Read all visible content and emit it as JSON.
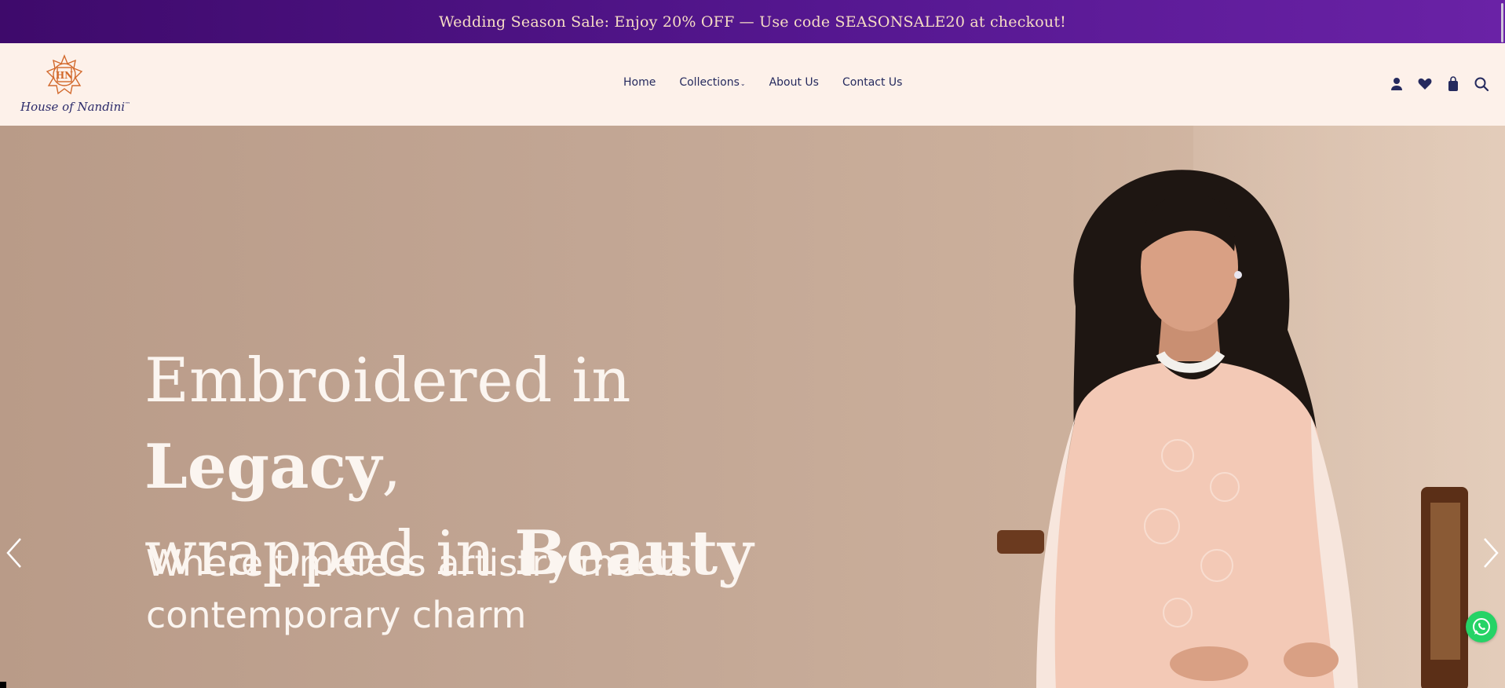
{
  "announcement": {
    "text": "Wedding Season Sale: Enjoy 20% OFF — Use code SEASONSALE20 at checkout!"
  },
  "header": {
    "logo": {
      "monogram": "HN",
      "text": "House of Nandini",
      "tm": "™"
    },
    "nav": [
      {
        "label": "Home"
      },
      {
        "label": "Collections",
        "has_dropdown": true
      },
      {
        "label": "About Us"
      },
      {
        "label": "Contact Us"
      }
    ],
    "icons": [
      "user-icon",
      "heart-icon",
      "shopping-bag-icon",
      "search-icon"
    ]
  },
  "hero": {
    "headline_line1_regular": "Embroidered in ",
    "headline_line1_bold": "Legacy",
    "headline_line1_end": ",",
    "headline_line2_regular": "wrapped in ",
    "headline_line2_bold": "Beauty",
    "subhead_line1": "Where timeless artistry meets",
    "subhead_line2": "contemporary charm",
    "prev_icon": "chevron-left-icon",
    "next_icon": "chevron-right-icon"
  },
  "floating": {
    "chat_icon": "whatsapp-icon"
  },
  "colors": {
    "announcement_bg_start": "#3e0a6b",
    "announcement_bg_end": "#6a22a6",
    "announcement_text": "#f6dcc4",
    "header_bg": "#fdf1ea",
    "nav_text": "#252a5e",
    "hero_bg": "#c2a694",
    "logo_accent": "#d2692c"
  }
}
